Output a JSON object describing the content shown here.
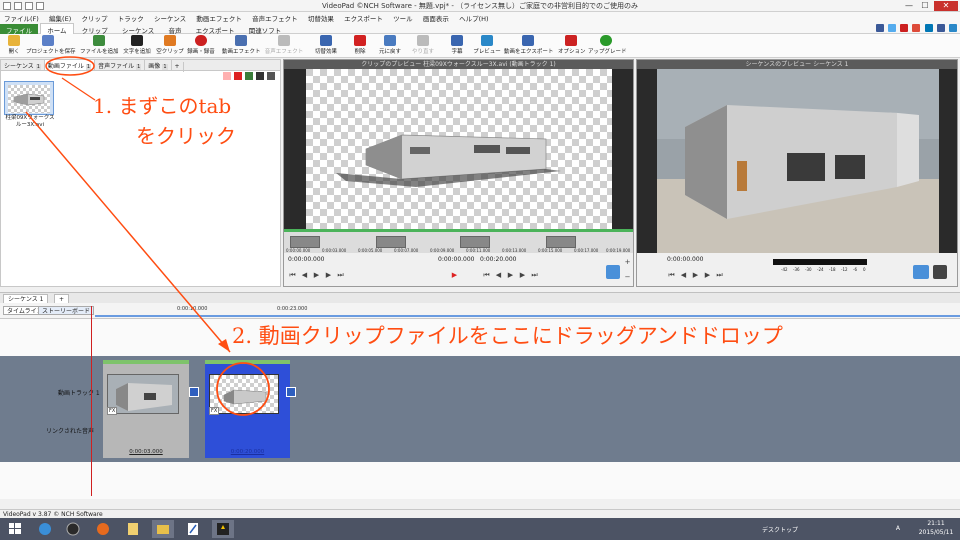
{
  "window": {
    "title": "VideoPad ©NCH Software - 無題.vpj* - （ライセンス無し）ご家庭での非営利目的でのご使用のみ",
    "min": "—",
    "max": "☐",
    "close": "✕"
  },
  "menubar": [
    "ファイル(F)",
    "編集(E)",
    "クリップ",
    "トラック",
    "シーケンス",
    "動画エフェクト",
    "音声エフェクト",
    "切替効果",
    "エクスポート",
    "ツール",
    "画面表示",
    "ヘルプ(H)"
  ],
  "ribbon_tabs": [
    "ファイル",
    "ホーム",
    "クリップ",
    "シーケンス",
    "音声",
    "エクスポート",
    "関連ソフト"
  ],
  "toolbar": [
    {
      "label": "開く",
      "color": "#e8b33a"
    },
    {
      "label": "プロジェクトを保存",
      "color": "#5b7fc7"
    },
    {
      "label": "ファイルを追加",
      "color": "#3d8c3d"
    },
    {
      "label": "文字を追加",
      "color": "#222222"
    },
    {
      "label": "空クリップ",
      "color": "#e07a22"
    },
    {
      "label": "録画・録音",
      "color": "#cc2020"
    },
    {
      "label": "動画エフェクト",
      "color": "#4a6fb0"
    },
    {
      "label": "音声エフェクト",
      "color": "#bbbbbb"
    },
    {
      "label": "切替効果",
      "color": "#3a66b0"
    },
    {
      "label": "削除",
      "color": "#d22222"
    },
    {
      "label": "元に戻す",
      "color": "#4a7bc0"
    },
    {
      "label": "やり直す",
      "color": "#bbbbbb"
    },
    {
      "label": "字幕",
      "color": "#3a66b0"
    },
    {
      "label": "プレビュー",
      "color": "#2a88c8"
    },
    {
      "label": "動画をエクスポート",
      "color": "#3a66b0"
    },
    {
      "label": "オプション",
      "color": "#cc2222"
    },
    {
      "label": "アップグレード",
      "color": "#2a9a2a"
    }
  ],
  "bin": {
    "tabs": [
      {
        "label": "シーケンス",
        "count": "1"
      },
      {
        "label": "動画ファイル",
        "count": "1"
      },
      {
        "label": "音声ファイル",
        "count": "1"
      },
      {
        "label": "画像",
        "count": "1"
      }
    ],
    "add_tab": "+",
    "clip_caption": "柱梁09Xウォークスルー3X.avi"
  },
  "clip_preview": {
    "title": "クリップのプレビュー 柱梁09Xウォークスルー3X.avi (動画トラック 1)",
    "ticks": [
      "0:00:00.000",
      "0:00:03.000",
      "0:00:05.000",
      "0:00:07.000",
      "0:00:09.000",
      "0:00:11.000",
      "0:00:13.000",
      "0:00:15.000",
      "0:00:17.000",
      "0:00:19.000"
    ],
    "time_left": "0:00:00.000",
    "time_mid": "0:00:00.000",
    "time_right": "0:00:20.000"
  },
  "seq_preview": {
    "title": "シーケンスのプレビュー シーケンス 1",
    "time": "0:00:00.000",
    "meter_labels": [
      "-42",
      "-36",
      "-30",
      "-24",
      "-18",
      "-12",
      "-6",
      "0"
    ]
  },
  "timeline": {
    "seq_tab": "シーケンス 1",
    "add": "+",
    "timeline_tab": "タイムライン",
    "storyboard_tab": "ストーリーボード",
    "ruler_marks": [
      "0:00:10.000",
      "0:00:23.000"
    ],
    "video_track_label": "動画トラック 1",
    "audio_link_label": "リンクされた音声",
    "clip1_time": "0:00:03.000",
    "clip2_time": "0:00:20.000",
    "fx": "FX"
  },
  "status": {
    "text": "VideoPad v 3.87 © NCH Software"
  },
  "tray": {
    "desktop": "デスクトップ",
    "ime": "A",
    "time": "21:11",
    "date": "2015/05/11"
  },
  "annotations": {
    "step1_line1": "1. まずこのtab",
    "step1_line2": "をクリック",
    "step2": "2. 動画クリップファイルをここにドラッグアンドドロップ",
    "color": "#ff4d12"
  }
}
